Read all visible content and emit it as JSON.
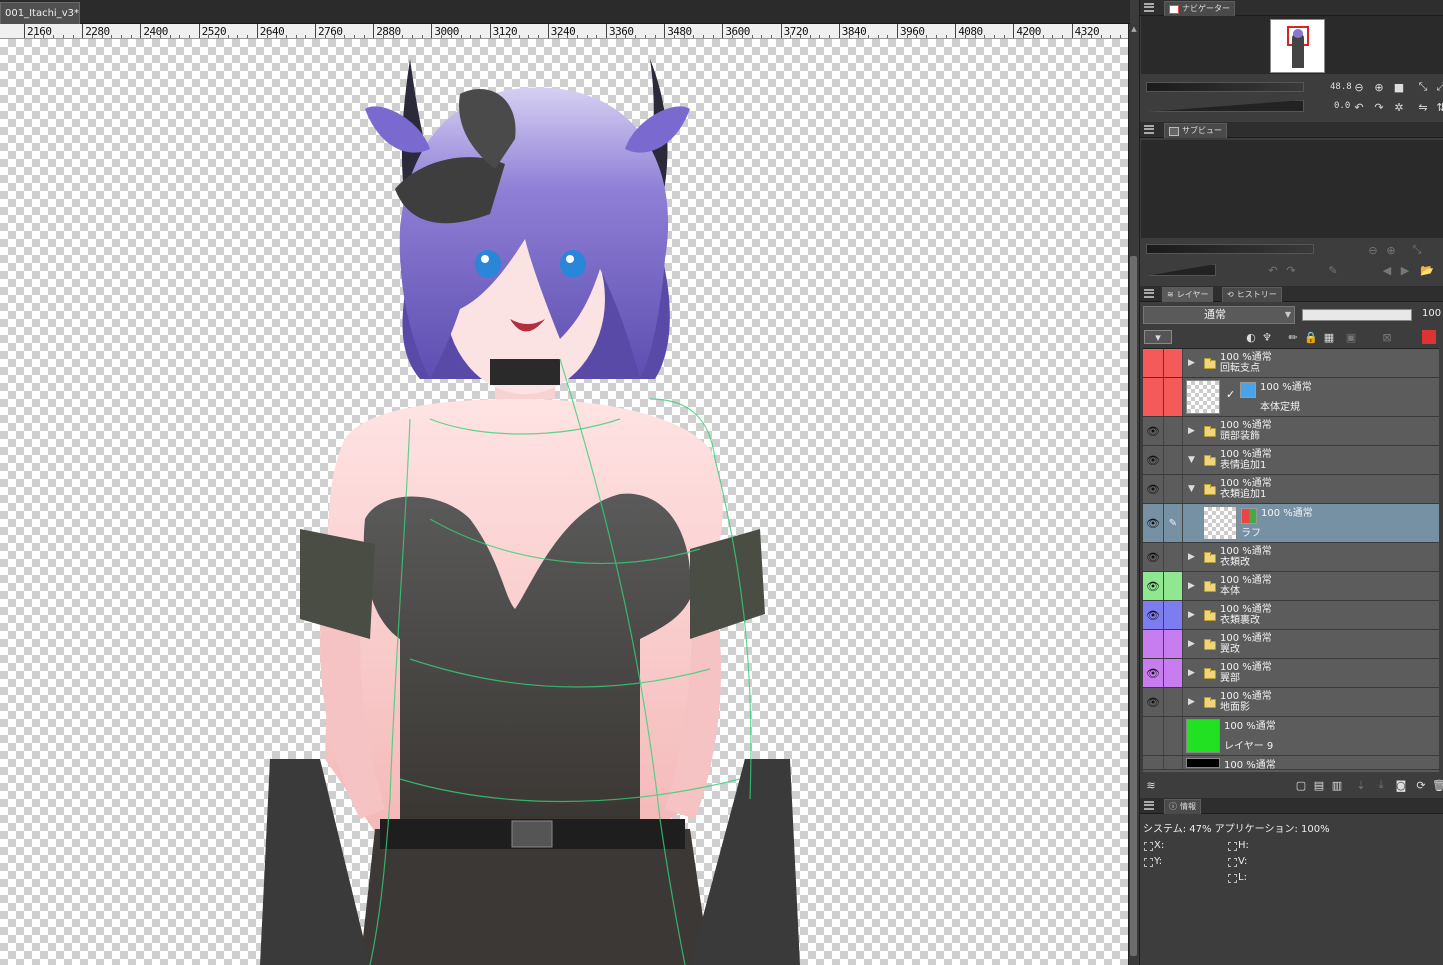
{
  "document": {
    "tab_title": "001_Itachi_v3*",
    "close": "●"
  },
  "ruler": {
    "labels": [
      "2160",
      "2280",
      "2400",
      "2520",
      "2640",
      "2760",
      "2880",
      "3000",
      "3120",
      "3240",
      "3360",
      "3480",
      "3600",
      "3720",
      "3840",
      "3960",
      "4080",
      "4200",
      "4320"
    ]
  },
  "navigator": {
    "tab_label": "ナビゲーター",
    "zoom": "48.8",
    "rotation": "0.0"
  },
  "subview": {
    "tab_label": "サブビュー"
  },
  "layer_panel": {
    "tab_layer": "レイヤー",
    "tab_history": "ヒストリー",
    "blend_mode": "通常",
    "opacity": "100",
    "layers": [
      {
        "type": "folder",
        "props": "100 %通常",
        "name": "回転支点",
        "color": "#f45a5a",
        "eye": "",
        "expand": "▶"
      },
      {
        "type": "layer",
        "props": "100 %通常",
        "name": "本体定規",
        "color": "#f45a5a",
        "eye": "",
        "expand": ""
      },
      {
        "type": "folder",
        "props": "100 %通常",
        "name": "頭部装飾",
        "color": "",
        "eye": "👁",
        "expand": "▶"
      },
      {
        "type": "folder-open",
        "props": "100 %通常",
        "name": "表情追加1",
        "color": "",
        "eye": "👁",
        "expand": "▼"
      },
      {
        "type": "folder-open",
        "props": "100 %通常",
        "name": "衣類追加1",
        "color": "",
        "eye": "👁",
        "expand": "▼"
      },
      {
        "type": "layer-selected",
        "props": "100 %通常",
        "name": "ラフ",
        "color": "",
        "eye": "👁",
        "expand": ""
      },
      {
        "type": "folder",
        "props": "100 %通常",
        "name": "衣類改",
        "color": "",
        "eye": "👁",
        "expand": "▶"
      },
      {
        "type": "folder",
        "props": "100 %通常",
        "name": "本体",
        "color": "#8fe88f",
        "eye": "👁",
        "expand": "▶"
      },
      {
        "type": "folder",
        "props": "100 %通常",
        "name": "衣類裏改",
        "color": "#7d7df0",
        "eye": "👁",
        "expand": "▶"
      },
      {
        "type": "folder",
        "props": "100 %通常",
        "name": "翼改",
        "color": "#c77df0",
        "eye": "",
        "expand": "▶"
      },
      {
        "type": "folder",
        "props": "100 %通常",
        "name": "翼部",
        "color": "#c77df0",
        "eye": "👁",
        "expand": "▶"
      },
      {
        "type": "folder",
        "props": "100 %通常",
        "name": "地面影",
        "color": "",
        "eye": "👁",
        "expand": "▶"
      },
      {
        "type": "layer-green",
        "props": "100 %通常",
        "name": "レイヤー 9",
        "color": "",
        "eye": "",
        "expand": ""
      },
      {
        "type": "layer-black",
        "props": "100 %通常",
        "name": "",
        "color": "",
        "eye": "",
        "expand": ""
      }
    ]
  },
  "info_panel": {
    "tab_label": "情報",
    "system_line": "システム: 47%  アプリケーション: 100%",
    "x_label": "X:",
    "y_label": "Y:",
    "h_label": "H:",
    "v_label": "V:",
    "l_label": "L:"
  },
  "colors": {
    "red_tag": "#f45a5a",
    "green_tag": "#8fe88f",
    "blue_tag": "#7d7df0",
    "purple_tag": "#c77df0",
    "selected_row": "#7791a4",
    "layer_green": "#22e022"
  }
}
